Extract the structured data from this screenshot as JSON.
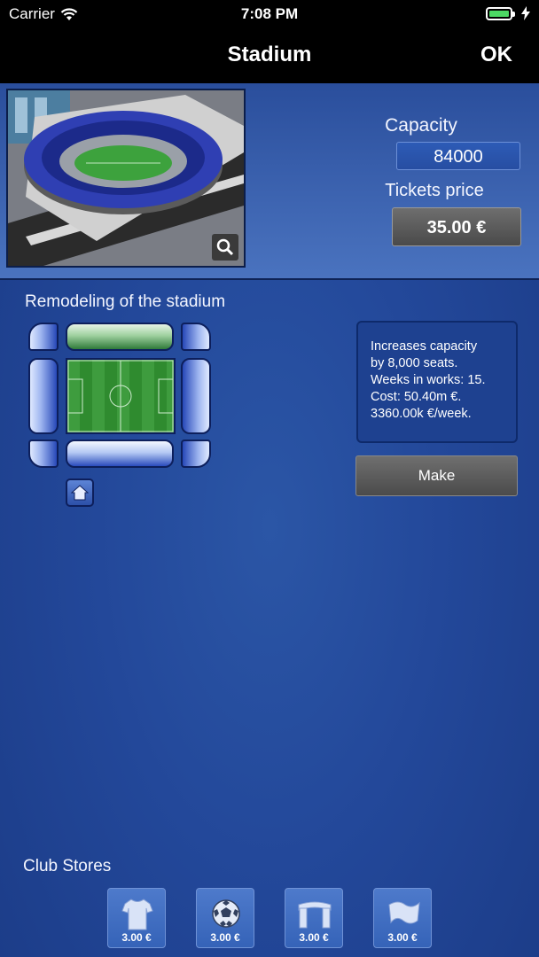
{
  "status_bar": {
    "carrier": "Carrier",
    "time": "7:08 PM"
  },
  "nav": {
    "title": "Stadium",
    "ok_label": "OK"
  },
  "stadium": {
    "capacity_label": "Capacity",
    "capacity_value": "84000",
    "tickets_label": "Tickets price",
    "tickets_value": "35.00 €"
  },
  "remodel": {
    "title": "Remodeling of the stadium",
    "info_lines": [
      "Increases capacity",
      "by 8,000 seats.",
      "Weeks in works: 15.",
      "Cost: 50.40m €.",
      "3360.00k €/week."
    ],
    "make_label": "Make"
  },
  "stores": {
    "title": "Club Stores",
    "items": [
      {
        "icon": "shirt-icon",
        "price": "3.00 €"
      },
      {
        "icon": "ball-icon",
        "price": "3.00 €"
      },
      {
        "icon": "scarf-icon",
        "price": "3.00 €"
      },
      {
        "icon": "flag-icon",
        "price": "3.00 €"
      }
    ]
  },
  "colors": {
    "background": "#23489a",
    "field_green": "#3e9c3e",
    "button_gray": "#5a5a5a"
  }
}
